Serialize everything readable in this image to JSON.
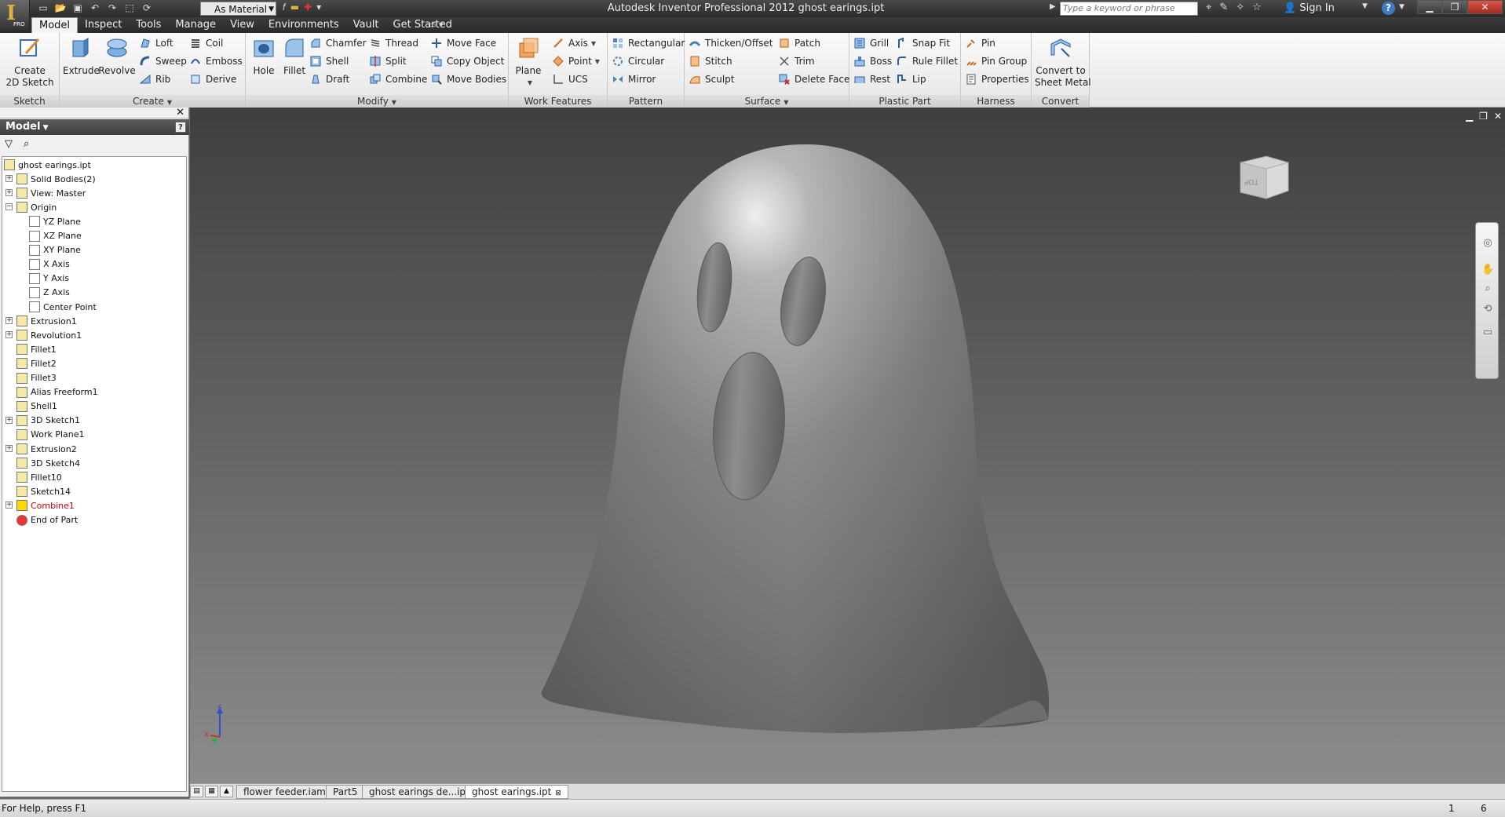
{
  "titlebar": {
    "material": "As Material",
    "title": "Autodesk Inventor Professional 2012    ghost earings.ipt",
    "search_placeholder": "Type a keyword or phrase",
    "sign_in": "Sign In",
    "help": "?"
  },
  "menu": {
    "tabs": [
      "Model",
      "Inspect",
      "Tools",
      "Manage",
      "View",
      "Environments",
      "Vault",
      "Get Started"
    ],
    "active": "Model"
  },
  "ribbon": {
    "sketch": {
      "label": "Sketch",
      "create_2d": "Create\n2D Sketch"
    },
    "create": {
      "label": "Create",
      "extrude": "Extrude",
      "revolve": "Revolve",
      "loft": "Loft",
      "sweep": "Sweep",
      "rib": "Rib",
      "coil": "Coil",
      "emboss": "Emboss",
      "derive": "Derive"
    },
    "modify": {
      "label": "Modify",
      "hole": "Hole",
      "fillet": "Fillet",
      "chamfer": "Chamfer",
      "shell": "Shell",
      "draft": "Draft",
      "thread": "Thread",
      "split": "Split",
      "combine": "Combine",
      "move_face": "Move Face",
      "copy_object": "Copy Object",
      "move_bodies": "Move Bodies"
    },
    "work_features": {
      "label": "Work Features",
      "plane": "Plane",
      "axis": "Axis",
      "point": "Point",
      "ucs": "UCS"
    },
    "pattern": {
      "label": "Pattern",
      "rectangular": "Rectangular",
      "circular": "Circular",
      "mirror": "Mirror"
    },
    "surface": {
      "label": "Surface",
      "thicken": "Thicken/Offset",
      "stitch": "Stitch",
      "sculpt": "Sculpt",
      "patch": "Patch",
      "trim": "Trim",
      "delete_face": "Delete Face"
    },
    "plastic": {
      "label": "Plastic Part",
      "grill": "Grill",
      "boss": "Boss",
      "rest": "Rest",
      "snap_fit": "Snap Fit",
      "rule_fillet": "Rule Fillet",
      "lip": "Lip"
    },
    "harness": {
      "label": "Harness",
      "pin": "Pin",
      "pin_group": "Pin Group",
      "properties": "Properties"
    },
    "convert": {
      "label": "Convert",
      "to_sheet": "Convert to\nSheet Metal"
    }
  },
  "browser": {
    "title": "Model",
    "help": "?",
    "tree": [
      {
        "label": "ghost earings.ipt",
        "depth": 0
      },
      {
        "label": "Solid Bodies(2)",
        "depth": 1
      },
      {
        "label": "View: Master",
        "depth": 1
      },
      {
        "label": "Origin",
        "depth": 1
      },
      {
        "label": "YZ Plane",
        "depth": 2
      },
      {
        "label": "XZ Plane",
        "depth": 2
      },
      {
        "label": "XY Plane",
        "depth": 2
      },
      {
        "label": "X Axis",
        "depth": 2
      },
      {
        "label": "Y Axis",
        "depth": 2
      },
      {
        "label": "Z Axis",
        "depth": 2
      },
      {
        "label": "Center Point",
        "depth": 2
      },
      {
        "label": "Extrusion1",
        "depth": 1
      },
      {
        "label": "Revolution1",
        "depth": 1
      },
      {
        "label": "Fillet1",
        "depth": 1
      },
      {
        "label": "Fillet2",
        "depth": 1
      },
      {
        "label": "Fillet3",
        "depth": 1
      },
      {
        "label": "Alias Freeform1",
        "depth": 1
      },
      {
        "label": "Shell1",
        "depth": 1
      },
      {
        "label": "3D Sketch1",
        "depth": 1
      },
      {
        "label": "Work Plane1",
        "depth": 1
      },
      {
        "label": "Extrusion2",
        "depth": 1
      },
      {
        "label": "3D Sketch4",
        "depth": 1
      },
      {
        "label": "Fillet10",
        "depth": 1
      },
      {
        "label": "Sketch14",
        "depth": 1
      },
      {
        "label": "Combine1",
        "depth": 1
      },
      {
        "label": "End of Part",
        "depth": 1
      }
    ]
  },
  "viewport": {
    "viewcube_face": "TOP",
    "axis_x": "X",
    "axis_z": "Z"
  },
  "doc_tabs": [
    "flower feeder.iam",
    "Part5",
    "ghost earings de...ipt",
    "ghost earings.ipt"
  ],
  "status": {
    "help_text": "For Help, press F1",
    "n1": "1",
    "n2": "6"
  }
}
